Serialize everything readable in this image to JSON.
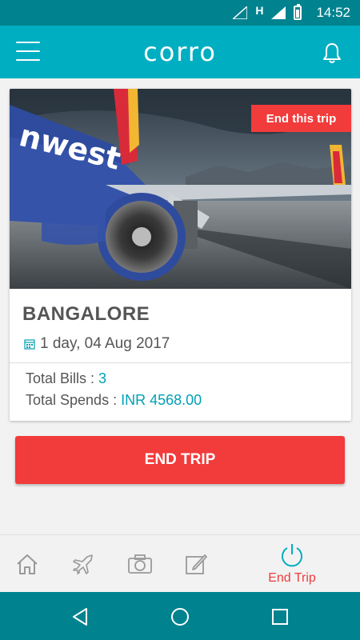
{
  "status_bar": {
    "time": "14:52",
    "network_label": "H"
  },
  "app_bar": {
    "logo_text": "corro"
  },
  "trip_card": {
    "badge_label": "End this trip",
    "city": "BANGALORE",
    "date_text": "1 day, 04 Aug 2017",
    "bills_label": "Total Bills :",
    "bills_value": "3",
    "spends_label": "Total Spends :",
    "spends_value": "INR 4568.00"
  },
  "end_trip_button": {
    "label": "END TRIP"
  },
  "bottom_nav": {
    "items": [
      {
        "icon": "home-icon"
      },
      {
        "icon": "flight-icon"
      },
      {
        "icon": "camera-icon"
      },
      {
        "icon": "edit-icon"
      },
      {
        "icon": "power-icon",
        "label": "End Trip"
      }
    ]
  },
  "colors": {
    "accent": "#00aec2",
    "status": "#00838f",
    "danger": "#f23b3b",
    "value_text": "#00a0b5"
  }
}
